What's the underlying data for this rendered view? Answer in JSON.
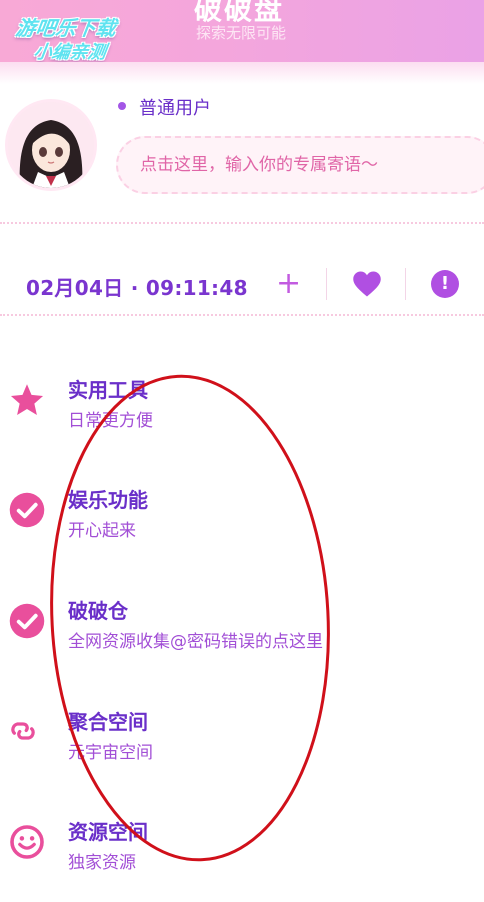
{
  "header": {
    "title": "破破盘",
    "subtitle": "探索无限可能",
    "watermark_line1": "游吧乐下载",
    "watermark_line2": "小编亲测"
  },
  "profile": {
    "user_type": "普通用户",
    "motto_placeholder": "点击这里，输入你的专属寄语～"
  },
  "status_bar": {
    "datetime": "02月04日 · 09:11:48",
    "plus_glyph": "+",
    "alert_glyph": "!"
  },
  "menu": [
    {
      "title": "实用工具",
      "desc": "日常更方便",
      "icon": "star-icon"
    },
    {
      "title": "娱乐功能",
      "desc": "开心起来",
      "icon": "check-circle-icon"
    },
    {
      "title": "破破仓",
      "desc": "全网资源收集@密码错误的点这里",
      "icon": "check-circle-icon"
    },
    {
      "title": "聚合空间",
      "desc": "元宇宙空间",
      "icon": "link-icon"
    },
    {
      "title": "资源空间",
      "desc": "独家资源",
      "icon": "smile-icon"
    }
  ],
  "colors": {
    "accent_purple": "#6a2fc9",
    "accent_pink": "#e94f9c",
    "header_pink": "#f4a6dc",
    "annotation_red": "#d0101a"
  }
}
